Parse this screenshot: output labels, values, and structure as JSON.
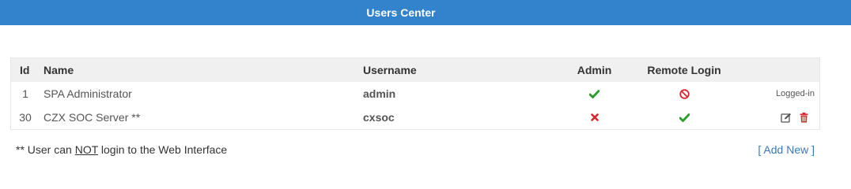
{
  "header": {
    "title": "Users Center"
  },
  "colors": {
    "header_bg": "#3382cc",
    "check": "#2a9d2a",
    "cross": "#d9282d",
    "ban": "#d9282d",
    "edit": "#555555",
    "delete": "#d9282d",
    "link": "#3a78b8"
  },
  "table": {
    "columns": {
      "id": "Id",
      "name": "Name",
      "username": "Username",
      "admin": "Admin",
      "remote_login": "Remote Login"
    },
    "rows": [
      {
        "id": "1",
        "name": "SPA Administrator",
        "username": "admin",
        "admin_icon": "check-icon",
        "remote_icon": "ban-icon",
        "status": "Logged-in"
      },
      {
        "id": "30",
        "name": "CZX SOC Server **",
        "username": "cxsoc",
        "admin_icon": "cross-icon",
        "remote_icon": "check-icon",
        "actions": [
          "edit-icon",
          "trash-icon"
        ]
      }
    ]
  },
  "footer": {
    "note_prefix": "** User can ",
    "note_emph": "NOT",
    "note_suffix": " login to the Web Interface",
    "add_new": "[ Add New ]"
  }
}
